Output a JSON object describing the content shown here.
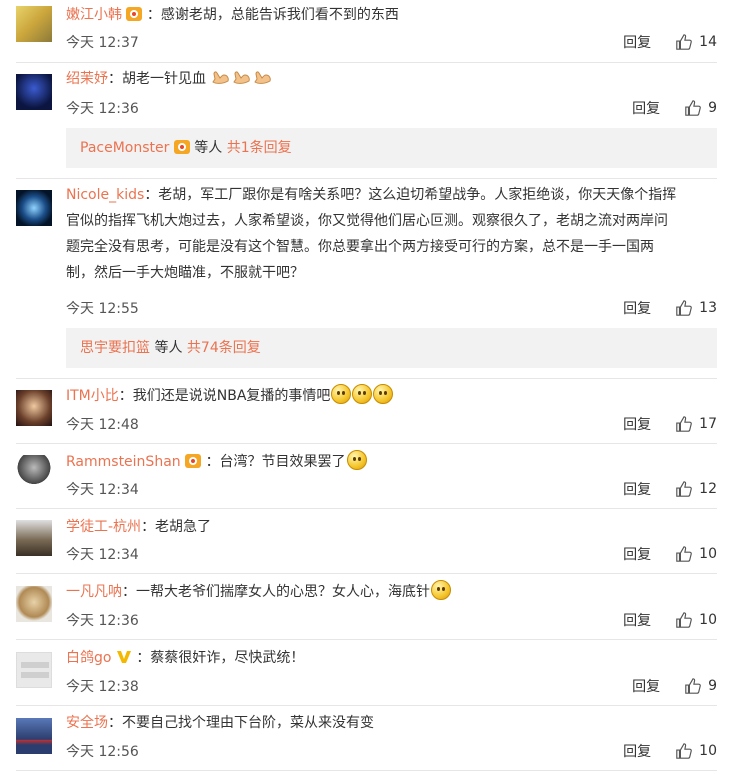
{
  "comments": [
    {
      "user": "嫩江小韩",
      "badge": "vip-icon",
      "text": "：感谢老胡，总能告诉我们看不到的东西",
      "time": "今天 12:37",
      "reply_label": "回复",
      "likes": "14"
    },
    {
      "user": "绍茉妤",
      "text": "：胡老一针见血",
      "emoji": "flexed-arm-icon ×3",
      "time": "今天 12:36",
      "reply_label": "回复",
      "likes": "9",
      "sub": {
        "user": "PaceMonster",
        "middle": "等人",
        "link": "共1条回复"
      }
    },
    {
      "user": "Nicole_kids",
      "text_lines": [
        "：老胡，军工厂跟你是有啥关系吧？这么迫切希望战争。人家拒绝谈，你天天像个指挥",
        "官似的指挥飞机大炮过去，人家希望谈，你又觉得他们居心叵测。观察很久了，老胡之流对两岸问",
        "题完全没有思考，可能是没有这个智慧。你总要拿出个两方接受可行的方案，总不是一手一国两",
        "制，然后一手大炮瞄准，不服就干吧？"
      ],
      "time": "今天 12:55",
      "reply_label": "回复",
      "likes": "13",
      "sub": {
        "user": "思宇要扣篮",
        "middle": "等人",
        "link": "共74条回复"
      }
    },
    {
      "user": "ITM小比",
      "text": "：我们还是说说NBA复播的事情吧",
      "time": "今天 12:48",
      "reply_label": "回复",
      "likes": "17"
    },
    {
      "user": "RammsteinShan",
      "text": "：台湾？节目效果罢了",
      "time": "今天 12:34",
      "reply_label": "回复",
      "likes": "12"
    },
    {
      "user": "学徒工-杭州",
      "text": "：老胡急了",
      "time": "今天 12:34",
      "reply_label": "回复",
      "likes": "10"
    },
    {
      "user": "一凡凡呐",
      "text": "：一帮大老爷们揣摩女人的心思？女人心，海底针",
      "time": "今天 12:36",
      "reply_label": "回复",
      "likes": "10"
    },
    {
      "user": "白鸽go",
      "text": "：蔡蔡很奸诈，尽快武统！",
      "time": "今天 12:38",
      "reply_label": "回复",
      "likes": "9"
    },
    {
      "user": "安全场",
      "text": "：不要自己找个理由下台阶，菜从来没有变",
      "time": "今天 12:56",
      "reply_label": "回复",
      "likes": "10"
    }
  ],
  "colors": {
    "username": "#eb7350",
    "text": "#333333",
    "sub_bg": "#f2f2f2",
    "separator": "#e6e6e6"
  }
}
